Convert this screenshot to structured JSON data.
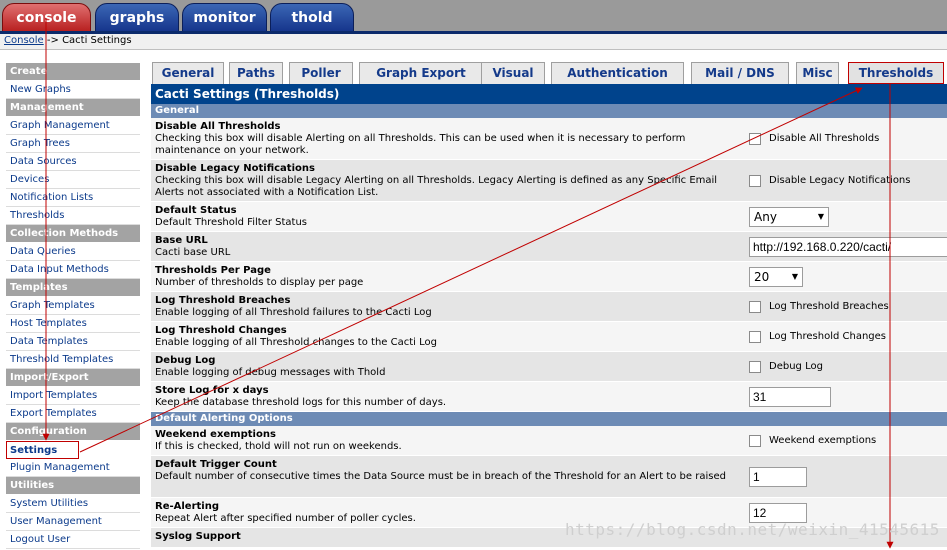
{
  "top_tabs": [
    {
      "label": "console"
    },
    {
      "label": "graphs"
    },
    {
      "label": "monitor"
    },
    {
      "label": "thold"
    }
  ],
  "breadcrumb": {
    "link": "Console",
    "sep": " -> ",
    "current": "Cacti Settings"
  },
  "sidebar": {
    "sections": [
      {
        "header": "Create",
        "items": [
          "New Graphs"
        ]
      },
      {
        "header": "Management",
        "items": [
          "Graph Management",
          "Graph Trees",
          "Data Sources",
          "Devices",
          "Notification Lists",
          "Thresholds"
        ]
      },
      {
        "header": "Collection Methods",
        "items": [
          "Data Queries",
          "Data Input Methods"
        ]
      },
      {
        "header": "Templates",
        "items": [
          "Graph Templates",
          "Host Templates",
          "Data Templates",
          "Threshold Templates"
        ]
      },
      {
        "header": "Import/Export",
        "items": [
          "Import Templates",
          "Export Templates"
        ]
      },
      {
        "header": "Configuration",
        "items": [
          "Settings",
          "Plugin Management"
        ]
      },
      {
        "header": "Utilities",
        "items": [
          "System Utilities",
          "User Management",
          "Logout User"
        ]
      }
    ]
  },
  "settings_tabs": [
    "General",
    "Paths",
    "Poller",
    "Graph Export",
    "Visual",
    "Authentication",
    "Mail / DNS",
    "Misc",
    "Thresholds"
  ],
  "panel_title": "Cacti Settings (Thresholds)",
  "section_general": "General",
  "section_alerting": "Default Alerting Options",
  "rows": {
    "disable_all": {
      "title": "Disable All Thresholds",
      "desc": "Checking this box will disable Alerting on all Thresholds. This can be used when it is necessary to perform maintenance on your network.",
      "checkbox_label": "Disable All Thresholds"
    },
    "disable_legacy": {
      "title": "Disable Legacy Notifications",
      "desc": "Checking this box will disable Legacy Alerting on all Thresholds. Legacy Alerting is defined as any Specific Email Alerts not associated with a Notification List.",
      "checkbox_label": "Disable Legacy Notifications"
    },
    "default_status": {
      "title": "Default Status",
      "desc": "Default Threshold Filter Status",
      "value": "Any"
    },
    "base_url": {
      "title": "Base URL",
      "desc": "Cacti base URL",
      "value": "http://192.168.0.220/cacti/"
    },
    "per_page": {
      "title": "Thresholds Per Page",
      "desc": "Number of thresholds to display per page",
      "value": "20"
    },
    "log_breaches": {
      "title": "Log Threshold Breaches",
      "desc": "Enable logging of all Threshold failures to the Cacti Log",
      "checkbox_label": "Log Threshold Breaches"
    },
    "log_changes": {
      "title": "Log Threshold Changes",
      "desc": "Enable logging of all Threshold changes to the Cacti Log",
      "checkbox_label": "Log Threshold Changes"
    },
    "debug_log": {
      "title": "Debug Log",
      "desc": "Enable logging of debug messages with Thold",
      "checkbox_label": "Debug Log"
    },
    "store_log": {
      "title": "Store Log for x days",
      "desc": "Keep the database threshold logs for this number of days.",
      "value": "31"
    },
    "weekend": {
      "title": "Weekend exemptions",
      "desc": "If this is checked, thold will not run on weekends.",
      "checkbox_label": "Weekend exemptions"
    },
    "trigger_count": {
      "title": "Default Trigger Count",
      "desc": "Default number of consecutive times the Data Source must be in breach of the Threshold for an Alert to be raised",
      "value": "1"
    },
    "realert": {
      "title": "Re-Alerting",
      "desc": "Repeat Alert after specified number of poller cycles.",
      "value": "12"
    },
    "syslog": {
      "title": "Syslog Support"
    }
  },
  "watermark": "https://blog.csdn.net/weixin_41545615",
  "colors": {
    "accent": "#00438c",
    "annotation": "#c00000"
  }
}
